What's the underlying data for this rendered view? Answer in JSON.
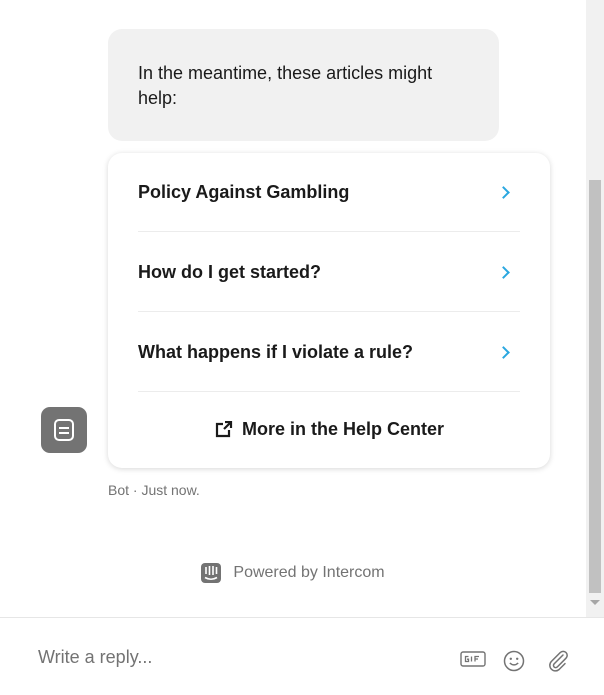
{
  "bubble": {
    "text": "In the meantime, these articles might help:"
  },
  "articles": [
    {
      "title": "Policy Against Gambling"
    },
    {
      "title": "How do I get started?"
    },
    {
      "title": "What happens if I violate a rule?"
    }
  ],
  "more": {
    "label": "More in the Help Center",
    "icon": "external-link-icon"
  },
  "meta": {
    "text": "Bot · Just now."
  },
  "powered": {
    "text": "Powered by Intercom",
    "icon": "intercom-logo"
  },
  "composer": {
    "placeholder": "Write a reply...",
    "tools": [
      "gif-icon",
      "emoji-icon",
      "attachment-icon"
    ]
  },
  "colors": {
    "accent": "#2aa7e0",
    "bubble_bg": "#f1f1f1",
    "avatar_bg": "#737373",
    "muted_text": "#737373"
  }
}
